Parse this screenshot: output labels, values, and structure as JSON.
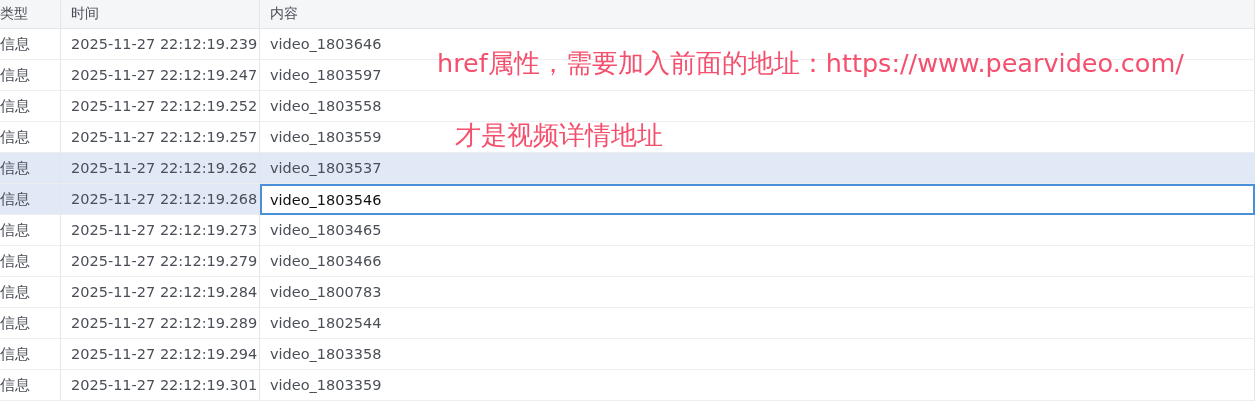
{
  "table": {
    "columns": [
      "类型",
      "时间",
      "内容"
    ],
    "rows": [
      {
        "type": "信息",
        "time": "2025-11-27 22:12:19.239",
        "content": "video_1803646",
        "selected": false,
        "editing": false
      },
      {
        "type": "信息",
        "time": "2025-11-27 22:12:19.247",
        "content": "video_1803597",
        "selected": false,
        "editing": false
      },
      {
        "type": "信息",
        "time": "2025-11-27 22:12:19.252",
        "content": "video_1803558",
        "selected": false,
        "editing": false
      },
      {
        "type": "信息",
        "time": "2025-11-27 22:12:19.257",
        "content": "video_1803559",
        "selected": false,
        "editing": false
      },
      {
        "type": "信息",
        "time": "2025-11-27 22:12:19.262",
        "content": "video_1803537",
        "selected": true,
        "editing": false
      },
      {
        "type": "信息",
        "time": "2025-11-27 22:12:19.268",
        "content": "video_1803546",
        "selected": true,
        "editing": true
      },
      {
        "type": "信息",
        "time": "2025-11-27 22:12:19.273",
        "content": "video_1803465",
        "selected": false,
        "editing": false
      },
      {
        "type": "信息",
        "time": "2025-11-27 22:12:19.279",
        "content": "video_1803466",
        "selected": false,
        "editing": false
      },
      {
        "type": "信息",
        "time": "2025-11-27 22:12:19.284",
        "content": "video_1800783",
        "selected": false,
        "editing": false
      },
      {
        "type": "信息",
        "time": "2025-11-27 22:12:19.289",
        "content": "video_1802544",
        "selected": false,
        "editing": false
      },
      {
        "type": "信息",
        "time": "2025-11-27 22:12:19.294",
        "content": "video_1803358",
        "selected": false,
        "editing": false
      },
      {
        "type": "信息",
        "time": "2025-11-27 22:12:19.301",
        "content": "video_1803359",
        "selected": false,
        "editing": false
      }
    ]
  },
  "annotations": [
    "href属性，需要加入前面的地址：https://www.pearvideo.com/",
    "才是视频详情地址"
  ]
}
